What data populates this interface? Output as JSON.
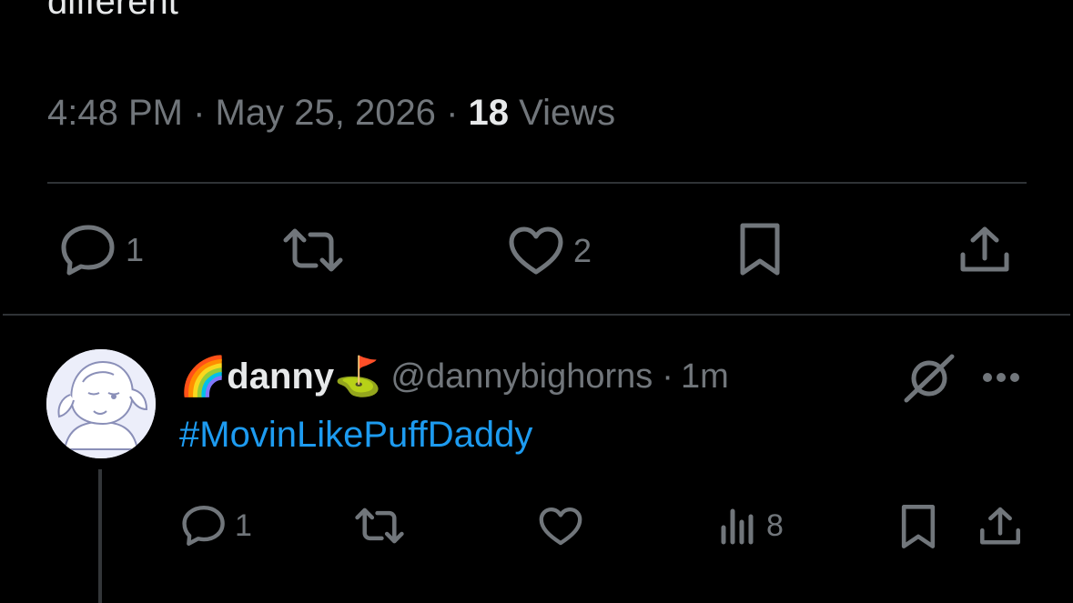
{
  "tweet": {
    "text_tail": "different",
    "time": "4:48 PM",
    "separator": "·",
    "date": "May 25, 2026",
    "views_count": "18",
    "views_label": "Views",
    "actions": {
      "reply_count": "1",
      "like_count": "2"
    }
  },
  "reply": {
    "display_name_prefix_emoji": "🌈",
    "display_name": "danny",
    "display_name_suffix_emoji": "⛳",
    "handle": "@dannybighorns",
    "separator": "·",
    "time": "1m",
    "hashtag": "#MovinLikePuffDaddy",
    "actions": {
      "reply_count": "1",
      "views_count": "8"
    }
  },
  "colors": {
    "background": "#000000",
    "text": "#e7e9ea",
    "muted": "#71767b",
    "link": "#1d9bf0",
    "divider": "#2f3336"
  },
  "icons": [
    "reply-icon",
    "retweet-icon",
    "like-icon",
    "bookmark-icon",
    "share-icon",
    "views-icon",
    "grok-icon",
    "more-icon"
  ]
}
